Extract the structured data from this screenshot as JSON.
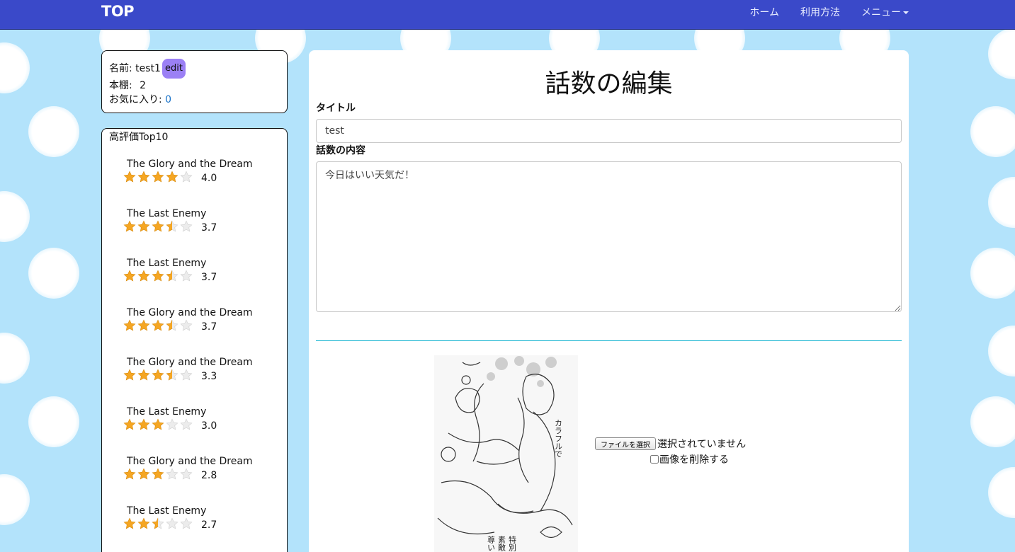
{
  "navbar": {
    "brand": "TOP",
    "links": [
      "ホーム",
      "利用方法",
      "メニュー"
    ]
  },
  "profile": {
    "name_label": "名前: test1",
    "edit_label": "edit",
    "bookshelf_label": "本棚:",
    "bookshelf_count": "2",
    "favorites_label": "お気に入り:",
    "favorites_count": "0"
  },
  "ranking": {
    "title": "高評価Top10",
    "items": [
      {
        "title": "The Glory and the Dream",
        "score": "4.0",
        "rating": 4.0
      },
      {
        "title": "The Last Enemy",
        "score": "3.7",
        "rating": 3.5
      },
      {
        "title": "The Last Enemy",
        "score": "3.7",
        "rating": 3.5
      },
      {
        "title": "The Glory and the Dream",
        "score": "3.7",
        "rating": 3.5
      },
      {
        "title": "The Glory and the Dream",
        "score": "3.3",
        "rating": 3.5
      },
      {
        "title": "The Last Enemy",
        "score": "3.0",
        "rating": 3.0
      },
      {
        "title": "The Glory and the Dream",
        "score": "2.8",
        "rating": 3.0
      },
      {
        "title": "The Last Enemy",
        "score": "2.7",
        "rating": 2.5
      }
    ]
  },
  "form": {
    "page_title": "話数の編集",
    "title_label": "タイトル",
    "title_value": "test",
    "content_label": "話数の内容",
    "content_value": "今日はいい天気だ！",
    "file_button_label": "ファイルを選択",
    "file_status": "選択されていません",
    "delete_image_label": "画像を削除する"
  },
  "colors": {
    "navbar": "#3a49c9",
    "background": "#b3e3fb",
    "edit_button": "#9b80f5",
    "star_full": "#f5a623",
    "divider": "#19b5d2"
  }
}
